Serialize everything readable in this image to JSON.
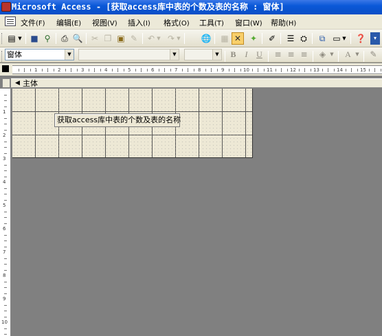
{
  "window": {
    "title": "Microsoft Access - [获取access库中表的个数及表的名称 : 窗体]"
  },
  "menu": {
    "items": [
      {
        "label": "文件",
        "key": "(F)"
      },
      {
        "label": "编辑",
        "key": "(E)"
      },
      {
        "label": "视图",
        "key": "(V)"
      },
      {
        "label": "插入",
        "key": "(I)"
      },
      {
        "label": "格式",
        "key": "(O)"
      },
      {
        "label": "工具",
        "key": "(T)"
      },
      {
        "label": "窗口",
        "key": "(W)"
      },
      {
        "label": "帮助",
        "key": "(H)"
      }
    ]
  },
  "format_toolbar": {
    "object_selector": "窗体",
    "font_name": "",
    "font_size": "",
    "bold": "B",
    "italic": "I",
    "underline": "U",
    "font_color": "A"
  },
  "ruler": {
    "h_numbers": [
      "1",
      "2",
      "3",
      "4",
      "5",
      "6",
      "7",
      "8",
      "9",
      "10",
      "11",
      "12",
      "13",
      "14",
      "15"
    ],
    "v_numbers": [
      "1",
      "2",
      "3",
      "4",
      "5",
      "6",
      "7",
      "8",
      "9",
      "10"
    ]
  },
  "form": {
    "section_label": "主体",
    "label_control_text": "获取access库中表的个数及表的名称"
  },
  "colors": {
    "titlebar": "#0a58d8",
    "chrome": "#ece9d8",
    "workspace": "#808080",
    "form_grid": "#ede8d5"
  }
}
